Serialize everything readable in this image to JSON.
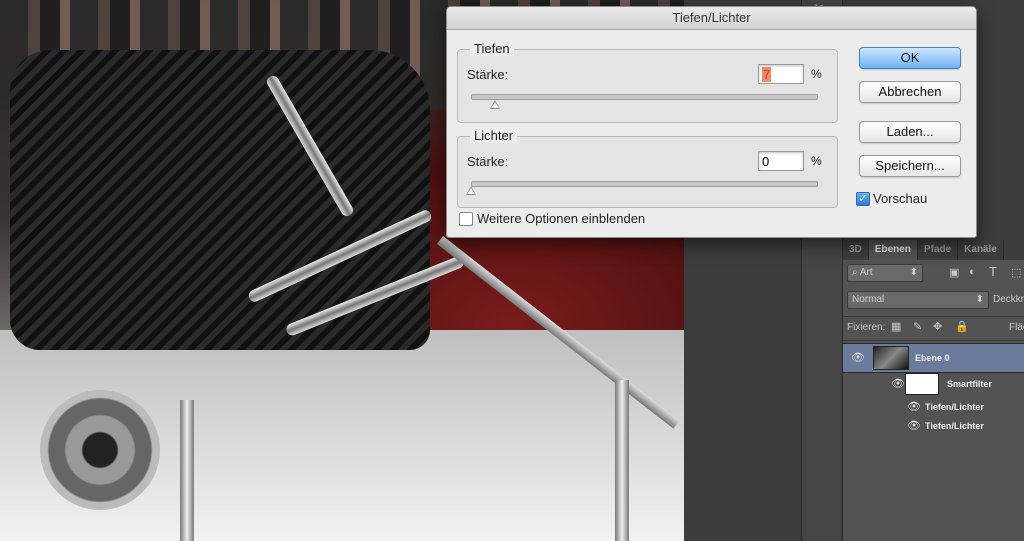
{
  "dialog": {
    "title": "Tiefen/Lichter",
    "tiefen": {
      "group_label": "Tiefen",
      "field_label": "Stärke:",
      "value": "7",
      "unit": "%",
      "slider_fraction": 0.07
    },
    "lichter": {
      "group_label": "Lichter",
      "field_label": "Stärke:",
      "value": "0",
      "unit": "%",
      "slider_fraction": 0.0
    },
    "more_options_label": "Weitere Optionen einblenden",
    "more_options_checked": false,
    "buttons": {
      "ok": "OK",
      "cancel": "Abbrechen",
      "load": "Laden...",
      "save": "Speichern..."
    },
    "preview_label": "Vorschau",
    "preview_checked": true
  },
  "layers_panel": {
    "tabs": [
      "3D",
      "Ebenen",
      "Pfade",
      "Kanäle"
    ],
    "active_tab": "Ebenen",
    "filter_kind": "Art",
    "blend_mode": "Normal",
    "opacity_label": "Deckkr",
    "lock_label": "Fixieren:",
    "fill_label": "Fläc",
    "layers": [
      {
        "name": "Ebene 0",
        "selected": true
      }
    ],
    "smart_filter_label": "Smartfilter",
    "filters": [
      "Tiefen/Lichter",
      "Tiefen/Lichter"
    ]
  },
  "colors": {
    "dialog_bg": "#ececec",
    "accent_button": "#6eb2f6",
    "selected_layer": "#6a7a9a",
    "panel_bg": "#535353"
  }
}
